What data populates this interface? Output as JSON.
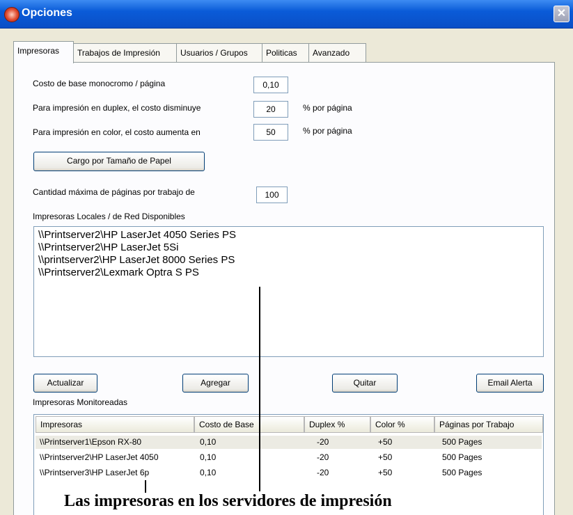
{
  "window": {
    "title": "Opciones",
    "close_label": "✕"
  },
  "tabs": [
    {
      "label": "Impresoras"
    },
    {
      "label": "Trabajos de Impresión"
    },
    {
      "label": "Usuarios / Grupos"
    },
    {
      "label": "Politicas"
    },
    {
      "label": "Avanzado"
    }
  ],
  "settings": {
    "mono_cost_label": "Costo de base monocromo / página",
    "mono_cost_value": "0,10",
    "duplex_label": "Para impresión en duplex, el costo disminuye",
    "duplex_value": "20",
    "duplex_unit": "% por página",
    "color_label": "Para impresión en color, el costo aumenta en",
    "color_value": "50",
    "color_unit": "% por página",
    "paper_size_button": "Cargo por Tamaño de Papel",
    "max_pages_label": "Cantidad máxima de páginas por trabajo de",
    "max_pages_value": "100"
  },
  "available": {
    "label": "Impresoras Locales / de Red Disponibles",
    "items": [
      "\\\\Printserver2\\HP LaserJet 4050 Series PS",
      "\\\\Printserver2\\HP LaserJet 5Si",
      "\\\\printserver2\\HP LaserJet 8000 Series PS",
      "\\\\Printserver2\\Lexmark Optra S PS"
    ]
  },
  "actions": {
    "refresh": "Actualizar",
    "add": "Agregar",
    "remove": "Quitar",
    "email": "Email Alerta"
  },
  "monitored": {
    "label": "Impresoras Monitoreadas",
    "columns": [
      "Impresoras",
      "Costo de Base",
      "Duplex %",
      "Color %",
      "Páginas por Trabajo"
    ],
    "rows": [
      [
        "\\\\Printserver1\\Epson RX-80",
        "0,10",
        "-20",
        "+50",
        "500 Pages"
      ],
      [
        "\\\\Printserver2\\HP LaserJet 4050",
        "0,10",
        "-20",
        "+50",
        "500 Pages"
      ],
      [
        "\\\\Printserver3\\HP LaserJet 6p",
        "0,10",
        "-20",
        "+50",
        "500 Pages"
      ]
    ]
  },
  "annotation": {
    "text": "Las impresoras en los servidores de impresión"
  }
}
